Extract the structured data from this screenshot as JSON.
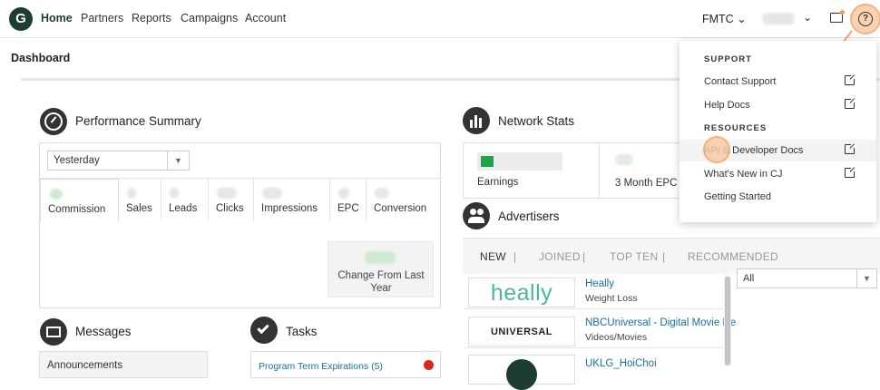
{
  "nav": {
    "logo_letter": "G",
    "items": [
      "Home",
      "Partners",
      "Reports",
      "Campaigns",
      "Account"
    ],
    "org": "FMTC",
    "caret": "⌄",
    "help_glyph": "?"
  },
  "dashboard": {
    "title": "Dashboard"
  },
  "performance": {
    "title": "Performance Summary",
    "period": "Yesterday",
    "metrics": [
      "Commission",
      "Sales",
      "Leads",
      "Clicks",
      "Impressions",
      "EPC",
      "Conversion"
    ],
    "change_label": "Change From Last Year"
  },
  "network": {
    "title": "Network Stats",
    "earnings_label": "Earnings",
    "epc_label": "3 Month EPC"
  },
  "advertisers": {
    "title": "Advertisers",
    "tabs": [
      "NEW",
      "JOINED",
      "TOP TEN",
      "RECOMMENDED"
    ],
    "filter": "All",
    "rows": [
      {
        "logo": "heally",
        "name": "Heally",
        "category": "Weight Loss"
      },
      {
        "logo": "UNIVERSAL",
        "name": "NBCUniversal - Digital Movie De",
        "category": "Videos/Movies"
      },
      {
        "logo": "",
        "name": "UKLG_HoiChoi",
        "category": ""
      }
    ]
  },
  "messages": {
    "title": "Messages",
    "first": "Announcements"
  },
  "tasks": {
    "title": "Tasks",
    "first": "Program Term Expirations (5)"
  },
  "menu": {
    "support_head": "SUPPORT",
    "support_items": [
      "Contact Support",
      "Help Docs"
    ],
    "resources_head": "RESOURCES",
    "resources_items": [
      "API & Developer Docs",
      "What's New in CJ",
      "Getting Started"
    ]
  },
  "colors": {
    "brand": "#1d3c34",
    "link": "#1a6fa3",
    "highlight": "#f2a66a",
    "green": "#1fa34a"
  }
}
